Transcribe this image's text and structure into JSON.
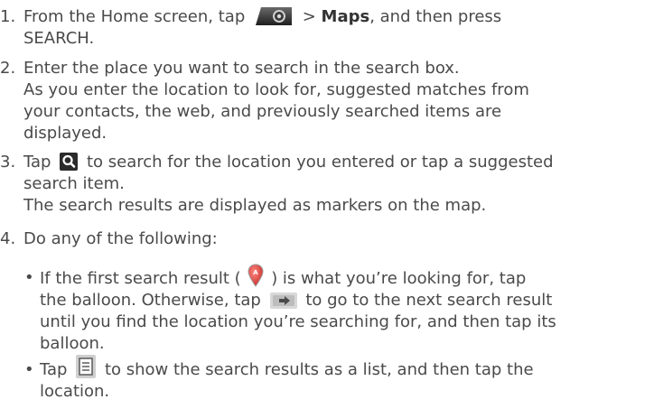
{
  "steps": [
    {
      "number": "1.",
      "lines": [
        "From the Home screen, tap",
        "> ",
        "Maps",
        ", and then press",
        "SEARCH."
      ]
    },
    {
      "number": "2.",
      "lines": [
        "Enter the place you want to search in the search box.",
        "As you enter the location to look for, suggested matches from",
        "your contacts, the web, and previously searched items are",
        "displayed."
      ]
    },
    {
      "number": "3.",
      "lines": [
        "Tap",
        "to search for the location you entered or tap a suggested",
        "search item.",
        "The search results are displayed as markers on the map."
      ]
    },
    {
      "number": "4.",
      "lines": [
        "Do any of the following:"
      ]
    }
  ],
  "bullets": [
    {
      "lines": [
        "If the first search result (",
        ") is what you’re looking for, tap",
        "the balloon. Otherwise, tap",
        "to go to the next search result",
        "until you find the location you’re searching for, and then tap its",
        "balloon."
      ]
    },
    {
      "lines": [
        "Tap",
        "to show the search results as a list, and then tap the",
        "location."
      ]
    }
  ],
  "bullet_glyph": "•",
  "icons": [
    "camera-icon",
    "search-icon",
    "map-marker-icon",
    "next-arrow-icon",
    "list-icon"
  ]
}
